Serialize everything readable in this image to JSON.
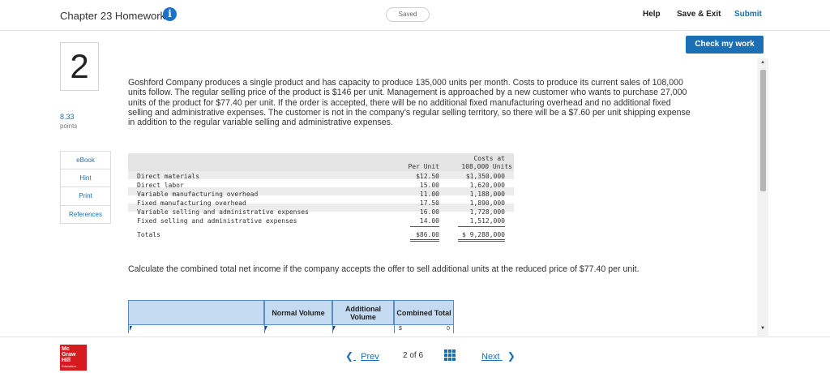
{
  "header": {
    "title": "Chapter 23 Homework",
    "saved_status": "Saved",
    "help_label": "Help",
    "save_exit_label": "Save & Exit",
    "submit_label": "Submit"
  },
  "check_button_label": "Check my work",
  "question": {
    "number": "2",
    "points_value": "8.33",
    "points_label": "points",
    "text": "Goshford Company produces a single product and has capacity to produce 135,000 units per month. Costs to produce its current sales of 108,000 units follow. The regular selling price of the product is $146 per unit. Management is approached by a new customer who wants to purchase 27,000 units of the product for $77.40 per unit. If the order is accepted, there will be no additional fixed manufacturing overhead and no additional fixed selling and administrative expenses. The customer is not in the company’s regular selling territory, so there will be a $7.60 per unit shipping expense in addition to the regular variable selling and administrative expenses.",
    "instruction": "Calculate the combined total net income if the company accepts the offer to sell additional units at the reduced price of $77.40 per unit."
  },
  "tools": [
    "eBook",
    "Hint",
    "Print",
    "References"
  ],
  "cost_table": {
    "header_unit": "Per Unit",
    "header_total_1": "Costs at",
    "header_total_2": "108,000 Units",
    "rows": [
      {
        "label": "Direct materials",
        "unit": "$12.50",
        "total": "$1,350,000"
      },
      {
        "label": "Direct labor",
        "unit": "15.00",
        "total": "1,620,000"
      },
      {
        "label": "Variable manufacturing overhead",
        "unit": "11.00",
        "total": "1,188,000"
      },
      {
        "label": "Fixed manufacturing overhead",
        "unit": "17.50",
        "total": "1,890,000"
      },
      {
        "label": "Variable selling and administrative expenses",
        "unit": "16.00",
        "total": "1,728,000"
      },
      {
        "label": "Fixed selling and administrative expenses",
        "unit": "14.00",
        "total": "1,512,000"
      }
    ],
    "totals": {
      "label": "Totals",
      "unit": "$86.00",
      "total": "$ 9,288,000"
    }
  },
  "answer_table": {
    "col_normal": "Normal Volume",
    "col_additional": "Additional Volume",
    "col_combined": "Combined Total",
    "row1_combined_currency": "$",
    "row1_combined_value": "0"
  },
  "footer": {
    "logo_line1": "Mc",
    "logo_line2": "Graw",
    "logo_line3": "Hill",
    "logo_line4": "Education",
    "prev_label": "Prev",
    "page_current": "2",
    "page_of": "of",
    "page_total": "6",
    "next_label": "Next"
  },
  "colors": {
    "accent": "#1a6fb5",
    "info_icon": "#1a73c8",
    "table_header_fill": "#c5dbf1",
    "logo_red": "#d71920"
  }
}
